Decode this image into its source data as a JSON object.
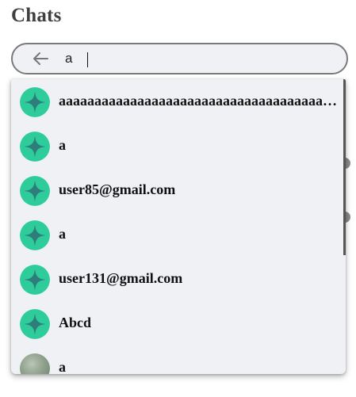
{
  "header": {
    "title": "Chats"
  },
  "search": {
    "value": "a",
    "placeholder": ""
  },
  "results": [
    {
      "label": "aaaaaaaaaaaaaaaaaaaaaaaaaaaaaaaaaaaaaaaaaaaa",
      "avatar": "sparkle-avatar"
    },
    {
      "label": "a",
      "avatar": "sparkle-avatar"
    },
    {
      "label": "user85@gmail.com",
      "avatar": "sparkle-avatar"
    },
    {
      "label": "a",
      "avatar": "sparkle-avatar"
    },
    {
      "label": "user131@gmail.com",
      "avatar": "sparkle-avatar"
    },
    {
      "label": "Abcd",
      "avatar": "sparkle-avatar"
    },
    {
      "label": "a",
      "avatar": "photo-avatar"
    }
  ],
  "colors": {
    "avatar_bg": "#2ecc9a",
    "avatar_sparkle": "#2d7d7a",
    "dropdown_bg": "#f0f1f5",
    "search_border": "#7a7a7a"
  }
}
